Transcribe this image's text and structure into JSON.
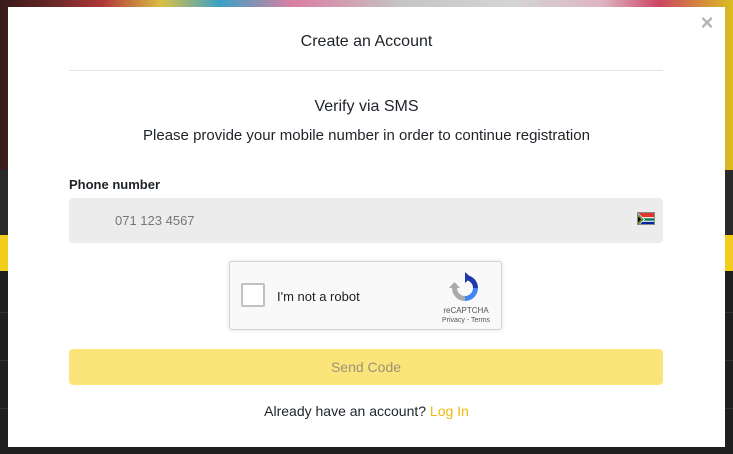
{
  "modal": {
    "close_symbol": "×",
    "title": "Create an Account",
    "verify_title": "Verify via SMS",
    "verify_description": "Please provide your mobile number in order to continue registration"
  },
  "phone": {
    "label": "Phone number",
    "placeholder": "071 123 4567",
    "country_flag": "south-africa-flag-icon"
  },
  "captcha": {
    "label": "I'm not a robot",
    "brand": "reCAPTCHA",
    "links": "Privacy - Terms"
  },
  "actions": {
    "send_code": "Send Code",
    "login_prompt": "Already have an account?",
    "login_link": "Log In"
  },
  "colors": {
    "accent": "#f0b90b",
    "button_disabled_bg": "#fbe57a",
    "input_bg": "#ececec"
  }
}
